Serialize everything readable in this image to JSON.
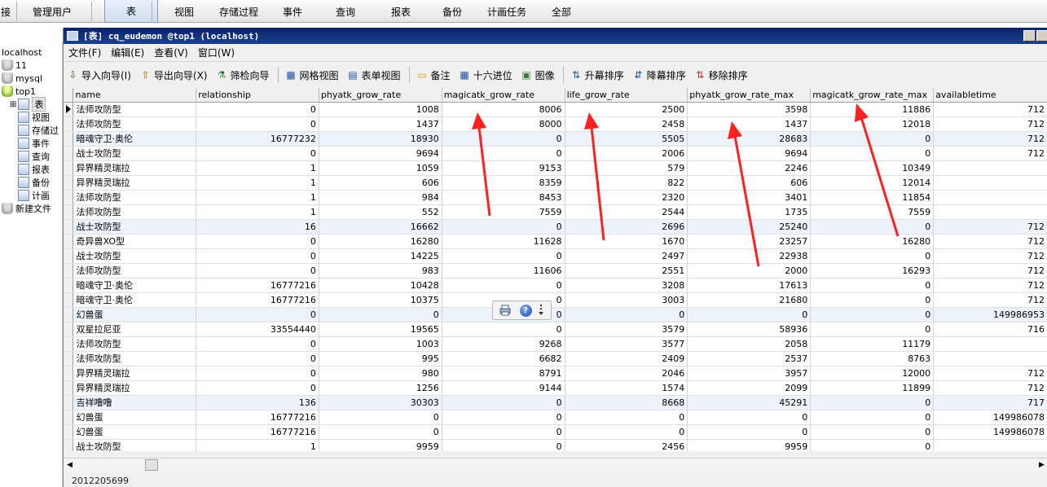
{
  "toolbar": {
    "items": [
      {
        "label": "接"
      },
      {
        "label": "管理用户"
      },
      {
        "label": "表"
      },
      {
        "label": "视图"
      },
      {
        "label": "存储过程"
      },
      {
        "label": "事件"
      },
      {
        "label": "查询"
      },
      {
        "label": "报表"
      },
      {
        "label": "备份"
      },
      {
        "label": "计画任务"
      },
      {
        "label": "全部"
      }
    ],
    "active": "表"
  },
  "tree": {
    "nodes": [
      {
        "label": "localhost"
      },
      {
        "label": "11"
      },
      {
        "label": "mysql"
      },
      {
        "label": "top1"
      },
      {
        "label": "表"
      },
      {
        "label": "视图"
      },
      {
        "label": "存储过"
      },
      {
        "label": "事件"
      },
      {
        "label": "查询"
      },
      {
        "label": "报表"
      },
      {
        "label": "备份"
      },
      {
        "label": "计画"
      },
      {
        "label": "新建文件"
      }
    ]
  },
  "window": {
    "title": "[表] cq_eudemon @top1 (localhost)",
    "menu": [
      "文件(F)",
      "编辑(E)",
      "查看(V)",
      "窗口(W)"
    ],
    "tools": [
      {
        "label": "导入向导(I)",
        "icon": "import-icon"
      },
      {
        "label": "导出向导(X)",
        "icon": "export-icon"
      },
      {
        "label": "筛检向导",
        "icon": "filter-icon"
      },
      {
        "label": "网格视图",
        "icon": "grid-view-icon"
      },
      {
        "label": "表单视图",
        "icon": "form-view-icon"
      },
      {
        "label": "备注",
        "icon": "memo-icon"
      },
      {
        "label": "十六进位",
        "icon": "hex-icon"
      },
      {
        "label": "图像",
        "icon": "image-icon"
      },
      {
        "label": "升幕排序",
        "icon": "sort-asc-icon"
      },
      {
        "label": "降幕排序",
        "icon": "sort-desc-icon"
      },
      {
        "label": "移除排序",
        "icon": "remove-sort-icon"
      }
    ]
  },
  "grid": {
    "columns": [
      "name",
      "relationship",
      "phyatk_grow_rate",
      "magicatk_grow_rate",
      "life_grow_rate",
      "phyatk_grow_rate_max",
      "magicatk_grow_rate_max",
      "availabletime"
    ],
    "rows": [
      [
        "法师攻防型",
        "0",
        "1008",
        "8006",
        "2500",
        "3598",
        "11886",
        "712"
      ],
      [
        "法师攻防型",
        "0",
        "1437",
        "8000",
        "2458",
        "1437",
        "12018",
        "712"
      ],
      [
        "暗魂守卫·奥伦",
        "16777232",
        "18930",
        "0",
        "5505",
        "28683",
        "0",
        "712"
      ],
      [
        "战士攻防型",
        "0",
        "9694",
        "0",
        "2006",
        "9694",
        "0",
        "712"
      ],
      [
        "异界精灵瑞拉",
        "1",
        "1059",
        "9153",
        "579",
        "2246",
        "10349",
        ""
      ],
      [
        "异界精灵瑞拉",
        "1",
        "606",
        "8359",
        "822",
        "606",
        "12014",
        ""
      ],
      [
        "法师攻防型",
        "1",
        "984",
        "8453",
        "2320",
        "3401",
        "11854",
        ""
      ],
      [
        "法师攻防型",
        "1",
        "552",
        "7559",
        "2544",
        "1735",
        "7559",
        ""
      ],
      [
        "战士攻防型",
        "16",
        "16662",
        "0",
        "2696",
        "25240",
        "0",
        "712"
      ],
      [
        "奇异兽XO型",
        "0",
        "16280",
        "11628",
        "1670",
        "23257",
        "16280",
        "712"
      ],
      [
        "战士攻防型",
        "0",
        "14225",
        "0",
        "2497",
        "22938",
        "0",
        "712"
      ],
      [
        "法师攻防型",
        "0",
        "983",
        "11606",
        "2551",
        "2000",
        "16293",
        "712"
      ],
      [
        "暗魂守卫·奥伦",
        "16777216",
        "10428",
        "0",
        "3208",
        "17613",
        "0",
        "712"
      ],
      [
        "暗魂守卫·奥伦",
        "16777216",
        "10375",
        "0",
        "3003",
        "21680",
        "0",
        "712"
      ],
      [
        "幻兽蛋",
        "0",
        "0",
        "0",
        "0",
        "0",
        "0",
        "149986953"
      ],
      [
        "双星拉尼亚",
        "33554440",
        "19565",
        "0",
        "3579",
        "58936",
        "0",
        "716"
      ],
      [
        "法师攻防型",
        "0",
        "1003",
        "9268",
        "3577",
        "2058",
        "11179",
        ""
      ],
      [
        "法师攻防型",
        "0",
        "995",
        "6682",
        "2409",
        "2537",
        "8763",
        ""
      ],
      [
        "异界精灵瑞拉",
        "0",
        "980",
        "8791",
        "2046",
        "3957",
        "12000",
        "712"
      ],
      [
        "异界精灵瑞拉",
        "0",
        "1256",
        "9144",
        "1574",
        "2099",
        "11899",
        "712"
      ],
      [
        "吉祥噜噜",
        "136",
        "30303",
        "0",
        "8668",
        "45291",
        "0",
        "717"
      ],
      [
        "幻兽蛋",
        "16777216",
        "0",
        "0",
        "0",
        "0",
        "0",
        "149986078"
      ],
      [
        "幻兽蛋",
        "16777216",
        "0",
        "0",
        "0",
        "0",
        "0",
        "149986078"
      ],
      [
        "战士攻防型",
        "1",
        "9959",
        "0",
        "2456",
        "9959",
        "0",
        ""
      ]
    ]
  },
  "status": {
    "text": "2012205699"
  },
  "popup": {
    "icons": [
      "print-icon",
      "help-icon",
      "more-icon"
    ],
    "help_label": "?"
  },
  "annotation": {
    "color": "#ff2020"
  }
}
